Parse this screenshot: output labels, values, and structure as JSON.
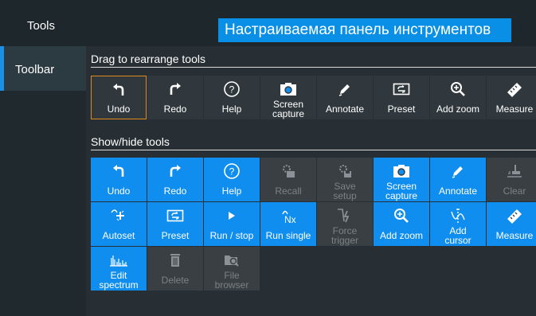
{
  "app_title": "Tools",
  "banner_text": "Настраиваемая панель инструментов",
  "sidebar": {
    "items": [
      {
        "label": "Toolbar"
      }
    ]
  },
  "toolbar_section": {
    "heading": "Drag to rearrange tools",
    "tools": [
      {
        "label": "Undo",
        "icon": "undo-icon"
      },
      {
        "label": "Redo",
        "icon": "redo-icon"
      },
      {
        "label": "Help",
        "icon": "help-icon"
      },
      {
        "label": "Screen\ncapture",
        "icon": "camera-icon"
      },
      {
        "label": "Annotate",
        "icon": "pen-icon"
      },
      {
        "label": "Preset",
        "icon": "preset-icon"
      },
      {
        "label": "Add zoom",
        "icon": "zoom-icon"
      },
      {
        "label": "Measure",
        "icon": "ruler-icon"
      }
    ]
  },
  "show_hide_section": {
    "heading": "Show/hide tools",
    "tools": [
      {
        "label": "Undo",
        "icon": "undo-icon",
        "enabled": true
      },
      {
        "label": "Redo",
        "icon": "redo-icon",
        "enabled": true
      },
      {
        "label": "Help",
        "icon": "help-icon",
        "enabled": true
      },
      {
        "label": "Recall",
        "icon": "recall-icon",
        "enabled": false
      },
      {
        "label": "Save\nsetup",
        "icon": "save-setup-icon",
        "enabled": false
      },
      {
        "label": "Screen\ncapture",
        "icon": "camera-icon",
        "enabled": true
      },
      {
        "label": "Annotate",
        "icon": "pen-icon",
        "enabled": true
      },
      {
        "label": "Clear",
        "icon": "clear-icon",
        "enabled": false
      },
      {
        "label": "Autoset",
        "icon": "autoset-icon",
        "enabled": true
      },
      {
        "label": "Preset",
        "icon": "preset-icon",
        "enabled": true
      },
      {
        "label": "Run / stop",
        "icon": "run-icon",
        "enabled": true
      },
      {
        "label": "Run single",
        "icon": "run-single-icon",
        "enabled": true
      },
      {
        "label": "Force\ntrigger",
        "icon": "force-trigger-icon",
        "enabled": false
      },
      {
        "label": "Add zoom",
        "icon": "zoom-icon",
        "enabled": true
      },
      {
        "label": "Add\ncursor",
        "icon": "cursor-icon",
        "enabled": true
      },
      {
        "label": "Measure",
        "icon": "ruler-icon",
        "enabled": true
      },
      {
        "label": "Edit\nspectrum",
        "icon": "spectrum-icon",
        "enabled": true
      },
      {
        "label": "Delete",
        "icon": "delete-icon",
        "enabled": false
      },
      {
        "label": "File\nbrowser",
        "icon": "file-browser-icon",
        "enabled": false
      }
    ]
  },
  "colors": {
    "accent": "#0f8ef0",
    "banner": "#0a8fe6",
    "selected_border": "#e08a1e",
    "disabled_tile": "#393f43"
  }
}
